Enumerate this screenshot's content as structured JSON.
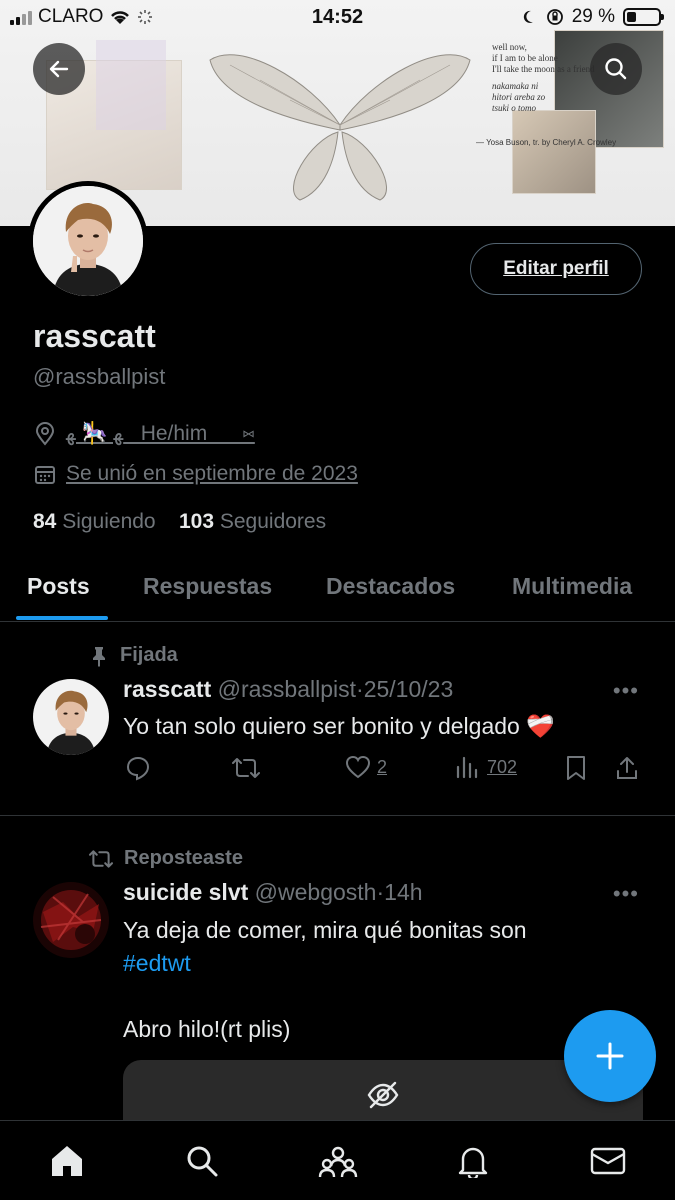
{
  "status_bar": {
    "carrier": "CLARO",
    "time": "14:52",
    "battery_percent": "29 %",
    "battery_level": 0.29
  },
  "profile": {
    "display_name": "rasscatt",
    "handle": "@rassballpist",
    "location": "ﻬ 🎠 ﻬ   He/him      ⑅",
    "joined": "Se unió en septiembre de 2023",
    "following_count": "84",
    "following_label": "Siguiendo",
    "followers_count": "103",
    "followers_label": "Seguidores",
    "edit_button": "Editar perfil"
  },
  "banner": {
    "quote_lines": [
      "well now,",
      "if I am to be alone",
      "I'll take the moon as a friend",
      "",
      "nakamaka ni",
      "hitori areba zo",
      "tsuki o tomo"
    ],
    "quote_credit": "— Yosa Buson, tr. by Cheryl A. Crowley"
  },
  "tabs": [
    {
      "label": "Posts",
      "active": true
    },
    {
      "label": "Respuestas",
      "active": false
    },
    {
      "label": "Destacados",
      "active": false
    },
    {
      "label": "Multimedia",
      "active": false
    }
  ],
  "posts": [
    {
      "context": "Fijada",
      "name": "rasscatt",
      "handle": "@rassballpist",
      "time": "25/10/23",
      "text": "Yo tan solo quiero ser bonito y delgado ❤️‍🩹",
      "likes": "2",
      "views": "702"
    },
    {
      "context": "Reposteaste",
      "name": "suicide slvt",
      "handle": "@webgosth",
      "time": "14h",
      "text_line1": "Ya deja de comer, mira qué bonitas son",
      "hashtag": "#edtwt",
      "text_line2": "Abro hilo!(rt plis)"
    }
  ],
  "icons": {
    "back": "arrow-left-icon",
    "search": "search-icon",
    "pin": "pin-icon",
    "repost": "repost-icon",
    "reply": "reply-icon",
    "like": "heart-icon",
    "views": "views-icon",
    "bookmark": "bookmark-icon",
    "share": "share-icon",
    "compose": "plus-icon",
    "hidden_media": "eye-off-icon",
    "nav": [
      "home-icon",
      "search-icon",
      "communities-icon",
      "notifications-icon",
      "messages-icon"
    ]
  },
  "colors": {
    "accent": "#1d9bf0",
    "muted": "#71767b",
    "text": "#e7e9ea",
    "border": "#2f3336"
  }
}
